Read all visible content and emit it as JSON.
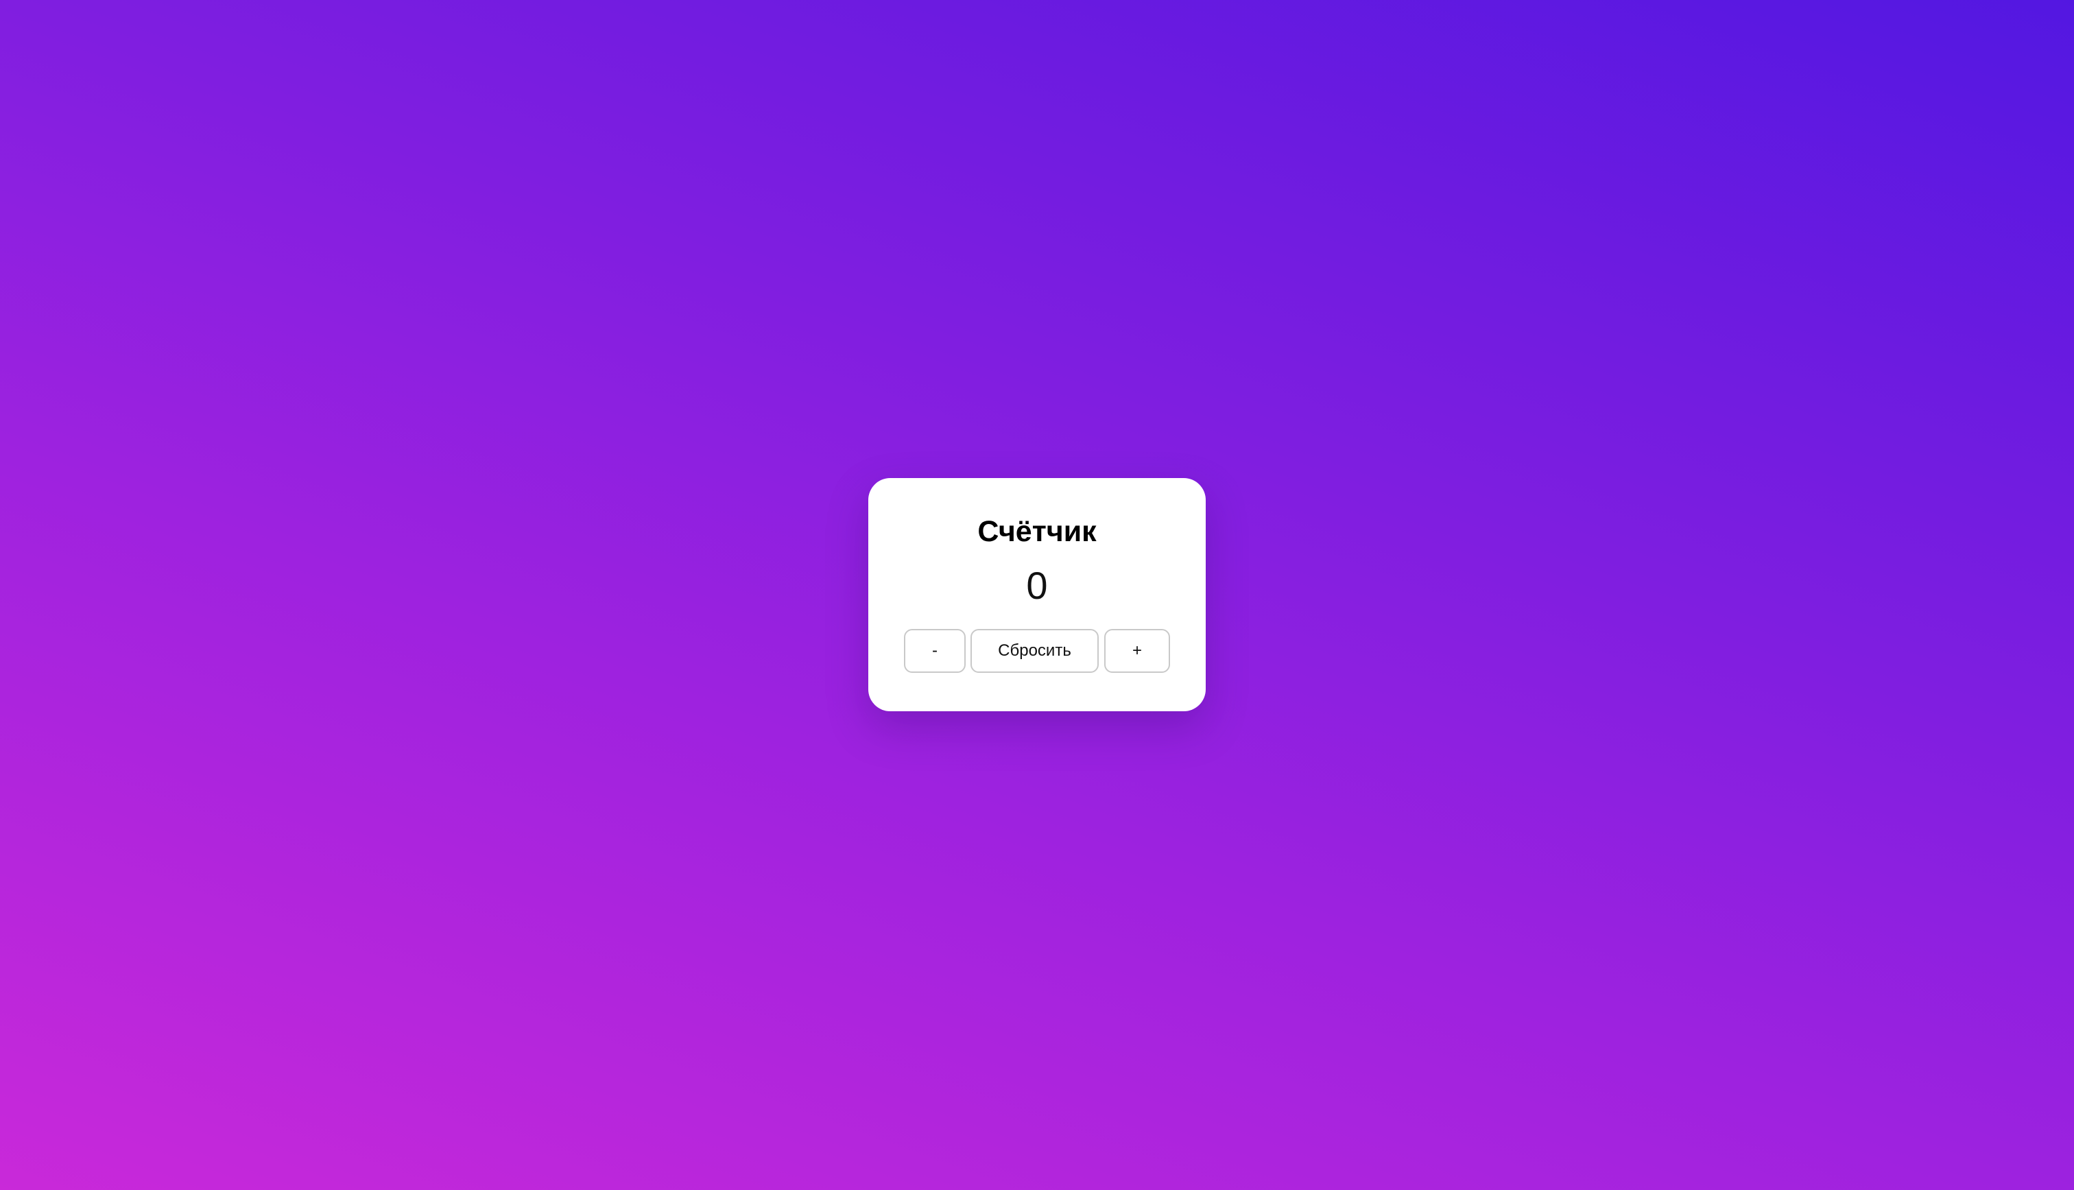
{
  "counter": {
    "title": "Счётчик",
    "value": "0",
    "buttons": {
      "decrement_label": "-",
      "reset_label": "Сбросить",
      "increment_label": "+"
    }
  },
  "colors": {
    "background_gradient_start": "#c929d9",
    "background_gradient_end": "#5317e1",
    "card_background": "#ffffff",
    "button_border": "#c9c9c9"
  }
}
